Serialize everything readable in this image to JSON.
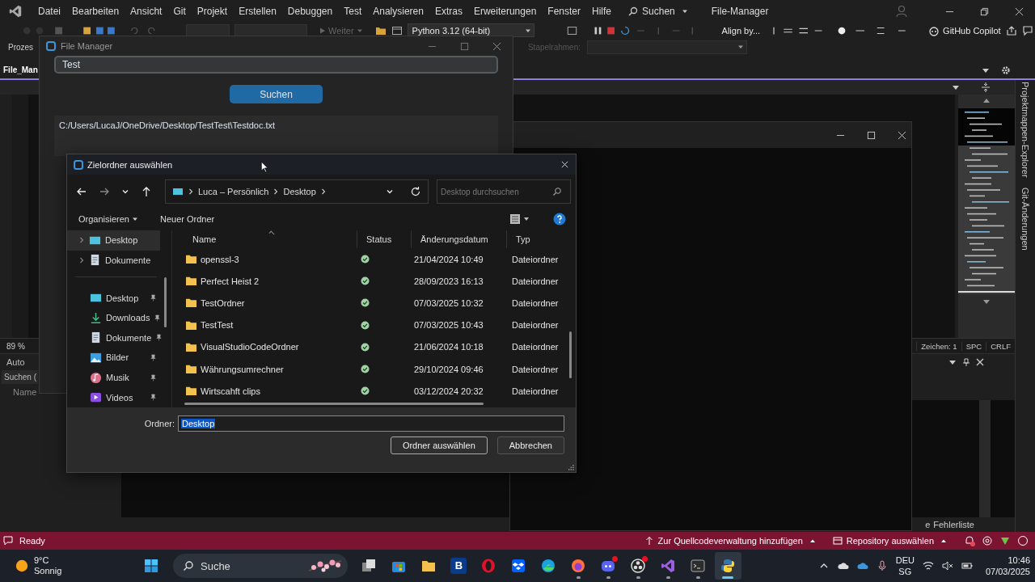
{
  "ide": {
    "menu": [
      "Datei",
      "Bearbeiten",
      "Ansicht",
      "Git",
      "Projekt",
      "Erstellen",
      "Debuggen",
      "Test",
      "Analysieren",
      "Extras",
      "Erweiterungen",
      "Fenster",
      "Hilfe"
    ],
    "search_menu": "Suchen",
    "title": "File-Manager",
    "toolbar": {
      "continue": "Weiter",
      "python_env": "Python 3.12 (64-bit)",
      "align": "Align by...",
      "copilot": "GitHub Copilot"
    },
    "process_label": "Prozes",
    "stack_label": "Stapelrahmen:",
    "doc_tab": "File_Man",
    "zoom": "89 %",
    "editor_status": [
      "Zeichen: 1",
      "SPC",
      "CRLF"
    ],
    "side_tabs": [
      "Projektmappen-Explorer",
      "Git-Änderungen"
    ],
    "panel": {
      "dropdown": "Auto",
      "search": "Suchen (",
      "column": "Name"
    },
    "bottom_tabs": [
      "e",
      "Fehlerliste"
    ],
    "status_bar": {
      "state": "Ready",
      "source_control": "Zur Quellcodeverwaltung hinzufügen",
      "repository": "Repository auswählen"
    }
  },
  "file_manager": {
    "title": "File Manager",
    "search_value": "Test",
    "button": "Suchen",
    "result": "C:/Users/LucaJ/OneDrive/Desktop/TestTest\\Testdoc.txt"
  },
  "dialog": {
    "title": "Zielordner auswählen",
    "breadcrumb": [
      "Luca – Persönlich",
      "Desktop"
    ],
    "search_placeholder": "Desktop durchsuchen",
    "commands": [
      "Organisieren",
      "Neuer Ordner"
    ],
    "tree": [
      {
        "label": "Desktop",
        "kind": "desktop",
        "selected": true
      },
      {
        "label": "Dokumente",
        "kind": "documents",
        "selected": false
      }
    ],
    "quick_access": [
      {
        "label": "Desktop",
        "kind": "desktop",
        "selected": false
      },
      {
        "label": "Downloads",
        "kind": "downloads",
        "selected": false
      },
      {
        "label": "Dokumente",
        "kind": "documents",
        "selected": false
      },
      {
        "label": "Bilder",
        "kind": "pictures",
        "selected": false
      },
      {
        "label": "Musik",
        "kind": "music",
        "selected": false
      },
      {
        "label": "Videos",
        "kind": "videos",
        "selected": false
      }
    ],
    "columns": [
      "Name",
      "Status",
      "Änderungsdatum",
      "Typ"
    ],
    "rows": [
      {
        "name": "openssl-3",
        "date": "21/04/2024 10:49",
        "type": "Dateiordner"
      },
      {
        "name": "Perfect Heist 2",
        "date": "28/09/2023 16:13",
        "type": "Dateiordner"
      },
      {
        "name": "TestOrdner",
        "date": "07/03/2025 10:32",
        "type": "Dateiordner"
      },
      {
        "name": "TestTest",
        "date": "07/03/2025 10:43",
        "type": "Dateiordner"
      },
      {
        "name": "VisualStudioCodeOrdner",
        "date": "21/06/2024 10:18",
        "type": "Dateiordner"
      },
      {
        "name": "Währungsumrechner",
        "date": "29/10/2024 09:46",
        "type": "Dateiordner"
      },
      {
        "name": "Wirtscahft clips",
        "date": "03/12/2024 20:32",
        "type": "Dateiordner"
      }
    ],
    "folder_label": "Ordner:",
    "folder_value": "Desktop",
    "buttons": [
      "Ordner auswählen",
      "Abbrechen"
    ]
  },
  "taskbar": {
    "temperature": "9°C",
    "weather": "Sonnig",
    "search": "Suche",
    "apps": [
      {
        "kind": "start",
        "running": false,
        "selected": false,
        "notification": false
      },
      {
        "kind": "taskview",
        "running": false,
        "selected": false,
        "notification": false
      },
      {
        "kind": "store",
        "running": false,
        "selected": false,
        "notification": false
      },
      {
        "kind": "folder",
        "running": false,
        "selected": false,
        "notification": false
      },
      {
        "kind": "letter",
        "label": "B",
        "running": false,
        "selected": false,
        "notification": false
      },
      {
        "kind": "opera",
        "running": false,
        "selected": false,
        "notification": false
      },
      {
        "kind": "dropbox",
        "running": false,
        "selected": false,
        "notification": false
      },
      {
        "kind": "edge",
        "running": false,
        "selected": false,
        "notification": false
      },
      {
        "kind": "firefox",
        "running": true,
        "selected": false,
        "notification": false
      },
      {
        "kind": "discord",
        "running": true,
        "selected": false,
        "notification": true
      },
      {
        "kind": "obs",
        "running": true,
        "selected": false,
        "notification": true
      },
      {
        "kind": "vs",
        "running": true,
        "selected": false,
        "notification": false
      },
      {
        "kind": "terminal",
        "running": true,
        "selected": false,
        "notification": false
      },
      {
        "kind": "python",
        "running": true,
        "selected": true,
        "notification": false
      }
    ],
    "language": "DEU",
    "layout": "SG",
    "time": "10:46",
    "date": "07/03/2025"
  }
}
